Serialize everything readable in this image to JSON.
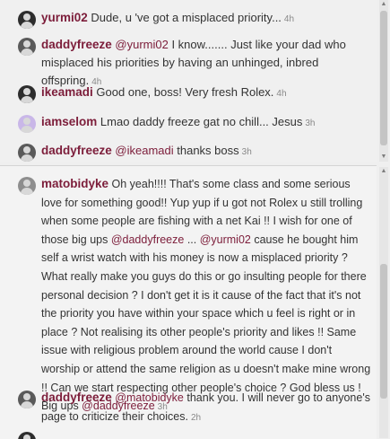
{
  "thread1": {
    "comments": [
      {
        "username": "yurmi02",
        "text": "Dude, u 've got a misplaced priority...",
        "time": "4h"
      },
      {
        "username": "daddyfreeze",
        "mention": "@yurmi02",
        "text": " I know....... Just like your dad who misplaced his priorities by having an unhinged, inbred offspring.",
        "time": "4h"
      },
      {
        "username": "ikeamadi",
        "text": "Good one, boss! Very fresh Rolex.",
        "time": "4h"
      },
      {
        "username": "iamselom",
        "text": "Lmao daddy freeze gat no chill... Jesus",
        "time": "3h"
      },
      {
        "username": "daddyfreeze",
        "mention": "@ikeamadi",
        "text": " thanks boss",
        "time": "3h"
      }
    ]
  },
  "thread2": {
    "comments": [
      {
        "username": "matobidyke",
        "text_a": "Oh yeah!!!! That's some class and some serious love for something good!! Yup yup if u got not Rolex u still trolling when some people are fishing with a net Kai !! I wish for one of those big ups ",
        "mention_a": "@daddyfreeze",
        "text_b": " ... ",
        "mention_b": "@yurmi02",
        "text_c": " cause he bought him self a wrist watch with his money is now a misplaced priority ? What really make you guys do this or go insulting people for there personal decision ? I don't get it is it cause of the fact that it's not the priority you have within your space which u feel is right or in place ? Not realising its other people's priority and likes !! Same issue with religious problem around the world cause I don't worship or attend the same religion as u doesn't make mine wrong !! Can we start respecting other people's choice ? God bless us ! Big ups ",
        "mention_c": "@daddyfreeze",
        "time": "3h"
      },
      {
        "username": "daddyfreeze",
        "mention": "@matobidyke",
        "text": " thank you. I will never go to anyone's page to criticize their choices.",
        "time": "2h"
      }
    ]
  },
  "scroll_arrows": {
    "up": "▲",
    "down": "▼"
  }
}
